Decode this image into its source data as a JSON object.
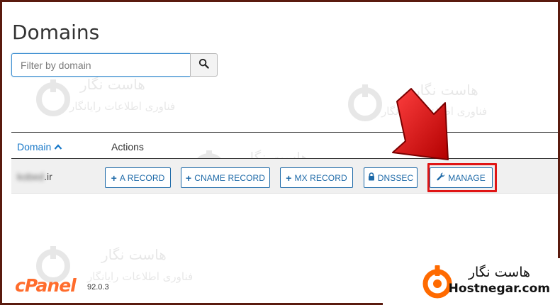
{
  "page": {
    "title": "Domains"
  },
  "search": {
    "placeholder": "Filter by domain",
    "button_icon": "search-icon"
  },
  "table": {
    "columns": {
      "domain": "Domain",
      "actions": "Actions"
    },
    "sort_icon": "chevron-up-icon",
    "rows": [
      {
        "domain_blurred": "kobed",
        "domain_suffix": ".ir",
        "actions": {
          "a_record": "A RECORD",
          "cname_record": "CNAME RECORD",
          "mx_record": "MX RECORD",
          "dnssec": "DNSSEC",
          "manage": "MANAGE"
        }
      }
    ]
  },
  "footer": {
    "logo_text": "cPanel",
    "version": "92.0.3"
  },
  "watermark": {
    "fa_name": "هاست نگار",
    "fa_tagline": "فناوری اطلاعات رایانگار"
  },
  "brand": {
    "fa_name": "هاست نگار",
    "en_name": "Hostnegar.com"
  },
  "colors": {
    "accent": "#1e6aa8",
    "link": "#1878c8",
    "highlight": "#e01515",
    "arrow": "#d81818",
    "cpanel": "#ff6c2c",
    "brand_orange": "#ff6a00"
  }
}
